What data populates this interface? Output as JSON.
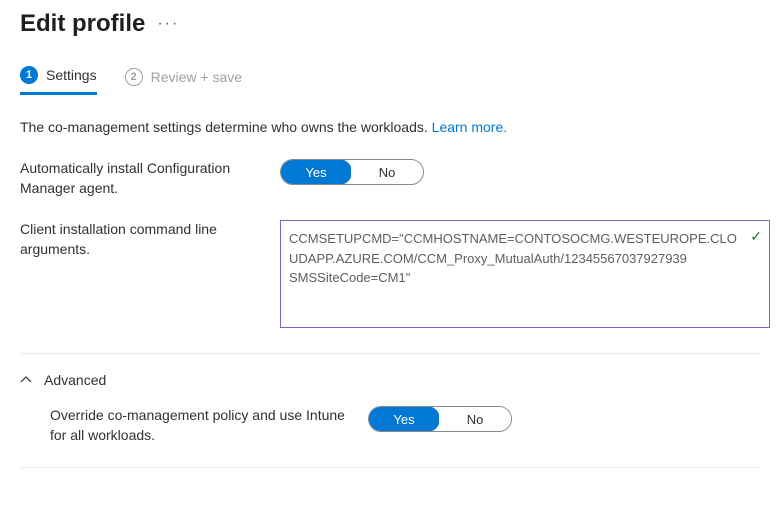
{
  "header": {
    "title": "Edit profile",
    "more_icon": "···"
  },
  "tabs": {
    "step1_num": "1",
    "step1_label": "Settings",
    "step2_num": "2",
    "step2_label": "Review + save"
  },
  "description": {
    "text": "The co-management settings determine who owns the workloads. ",
    "link": "Learn more."
  },
  "settings": {
    "auto_install_label": "Automatically install Configuration Manager agent.",
    "cmd_line_label": "Client installation command line arguments.",
    "cmd_line_value": "CCMSETUPCMD=\"CCMHOSTNAME=CONTOSOCMG.WESTEUROPE.CLOUDAPP.AZURE.COM/CCM_Proxy_MutualAuth/12345567037927939 SMSSiteCode=CM1\""
  },
  "toggle": {
    "yes": "Yes",
    "no": "No"
  },
  "advanced": {
    "title": "Advanced",
    "override_label": "Override co-management policy and use Intune for all workloads."
  }
}
